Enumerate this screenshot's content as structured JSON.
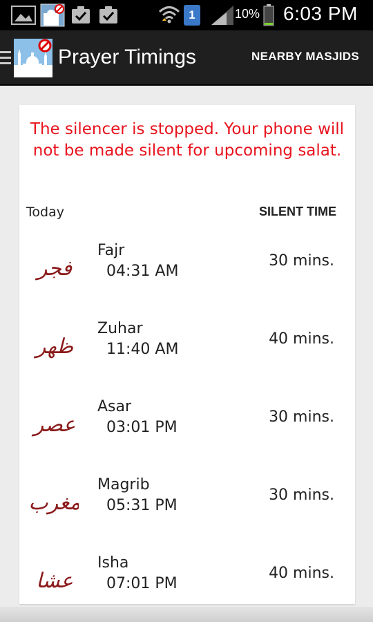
{
  "status_bar": {
    "battery_text": "10%",
    "time": "6:03 PM",
    "notification_count": "1",
    "icons": [
      "gallery-icon",
      "silencer-app-icon",
      "task-check-icon",
      "task-check-icon",
      "wifi-icon",
      "notification-badge-icon",
      "signal-icon",
      "battery-icon"
    ],
    "colors": {
      "background": "#000000",
      "battery_fill": "#7bd12a",
      "badge": "#3a78c8"
    }
  },
  "action_bar": {
    "title": "Prayer Timings",
    "action_label": "NEARBY MASJIDS",
    "icons": [
      "menu-icon",
      "app-logo-icon"
    ]
  },
  "main": {
    "notice": "The silencer is stopped. Your phone will not be made silent for upcoming salat.",
    "notice_color": "#e8141e",
    "today_label": "Today",
    "silent_time_header": "SILENT TIME",
    "prayers": [
      {
        "name": "Fajr",
        "time": "04:31 AM",
        "silent": "30 mins.",
        "icon": "fajr-calligraphy-icon",
        "arabic": "فجر"
      },
      {
        "name": "Zuhar",
        "time": "11:40 AM",
        "silent": "40 mins.",
        "icon": "zuhar-calligraphy-icon",
        "arabic": "ظهر"
      },
      {
        "name": "Asar",
        "time": "03:01 PM",
        "silent": "30 mins.",
        "icon": "asar-calligraphy-icon",
        "arabic": "عصر"
      },
      {
        "name": "Magrib",
        "time": "05:31 PM",
        "silent": "30 mins.",
        "icon": "magrib-calligraphy-icon",
        "arabic": "مغرب"
      },
      {
        "name": "Isha",
        "time": "07:01 PM",
        "silent": "40 mins.",
        "icon": "isha-calligraphy-icon",
        "arabic": "عشا"
      }
    ],
    "calligraphy_color": "#8b1a1a"
  }
}
